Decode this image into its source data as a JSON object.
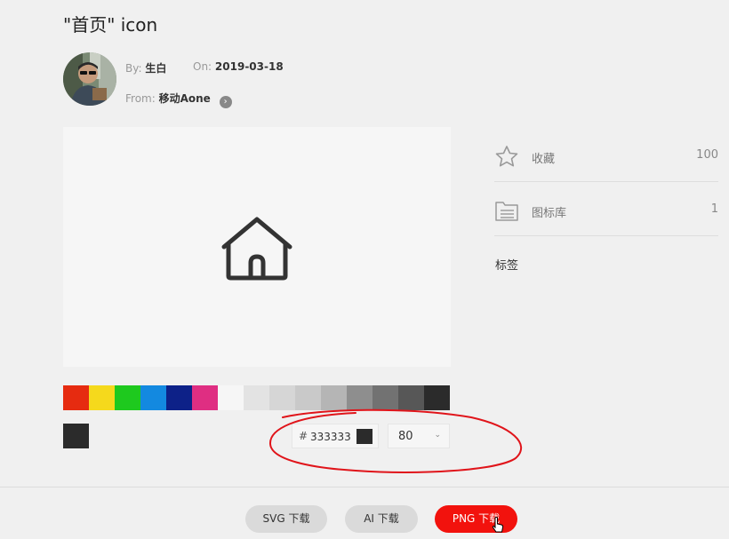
{
  "header": {
    "title": "\"首页\" icon"
  },
  "author": {
    "by_label": "By:",
    "by_name": "生白",
    "on_label": "On:",
    "date": "2019-03-18",
    "from_label": "From:",
    "from_name": "移动Aone"
  },
  "preview": {
    "icon_name": "home-icon"
  },
  "palette": {
    "colors": [
      "#e62b10",
      "#f5d91c",
      "#1ec91e",
      "#1389e0",
      "#0d2188",
      "#df2e82",
      "#f6f6f6",
      "#e3e3e3",
      "#d6d6d6",
      "#c9c9c9",
      "#b5b5b5",
      "#8e8e8e",
      "#727272",
      "#575757",
      "#2b2b2b"
    ],
    "current": "#2b2b2b"
  },
  "color_input": {
    "hash": "#",
    "value": "333333",
    "chip_color": "#2b2b2b"
  },
  "size_select": {
    "value": "80"
  },
  "sidebar": {
    "favorite": {
      "label": "收藏",
      "count": "100"
    },
    "library": {
      "label": "图标库",
      "count": "1"
    },
    "tags_label": "标签"
  },
  "download": {
    "svg": "SVG 下载",
    "ai": "AI 下载",
    "png": "PNG 下载"
  },
  "annotation_color": "#e0141a"
}
